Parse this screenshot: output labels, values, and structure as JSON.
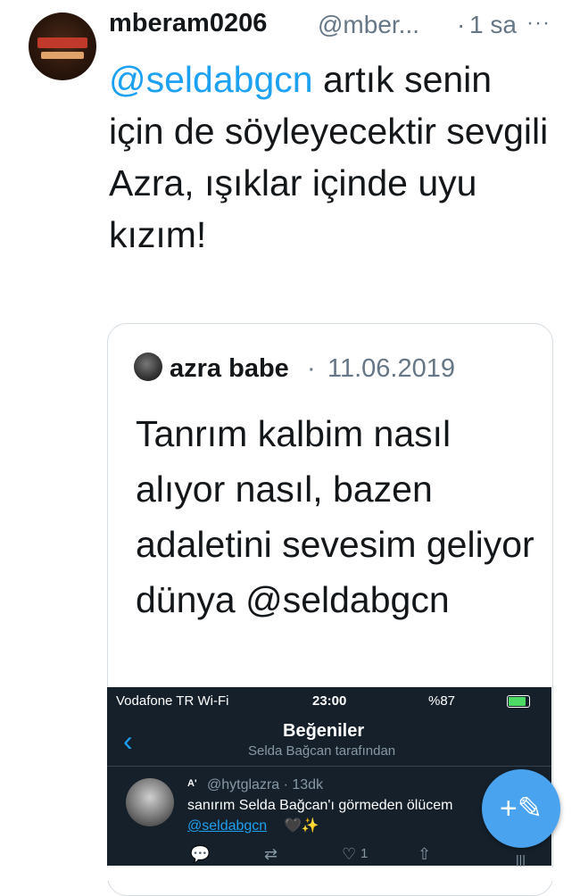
{
  "tweet": {
    "username": "mberam0206",
    "handle": "@mber...",
    "separator": "·",
    "time": "1 sa",
    "more_icon": "more-icon",
    "more_glyph": "···",
    "text_mention": "@seldabgcn",
    "text_body": " artık senin için de söyleyecektir sevgili Azra, ışıklar içinde uyu kızım!"
  },
  "quoted": {
    "name": "azra babe",
    "separator": "·",
    "date": "11.06.2019",
    "text": "Tanrım kalbim nasıl alıyor nasıl, bazen adaletini sevesim geliyor dünya @seldabgcn"
  },
  "embedded_screenshot": {
    "status_bar": {
      "carrier": "Vodafone TR Wi-Fi",
      "time": "23:00",
      "right": "%87"
    },
    "header": {
      "back_glyph": "‹",
      "title": "Beğeniler",
      "subtitle": "Selda Bağcan tarafından"
    },
    "reply": {
      "initials": "A'",
      "handle": "@hytglazra · 13dk",
      "text": "sanırım Selda Bağcan'ı görmeden ölücem",
      "mention": "@seldabgcn",
      "emoji": "🖤✨"
    },
    "actions": {
      "reply_glyph": "💬",
      "retweet_glyph": "⇄",
      "like_glyph": "♡",
      "like_count": "1",
      "share_glyph": "⇧"
    },
    "fab_glyph": "+✎",
    "tab_glyph": "|||"
  },
  "colors": {
    "link": "#1da1f2",
    "secondary": "#657786",
    "dark_bg": "#15202b"
  }
}
